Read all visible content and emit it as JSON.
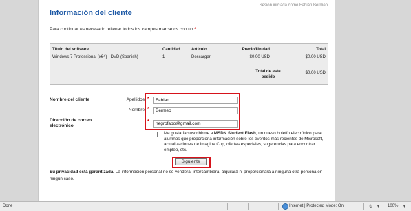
{
  "session": {
    "text": "Sesión iniciada como Fabián Bermeo"
  },
  "page": {
    "title": "Información del cliente",
    "intro": "Para continuar es necesario rellenar todos los campos marcados con un",
    "required_marker": "*.",
    "asterisk": "*"
  },
  "order": {
    "headers": {
      "title": "Título del software",
      "quantity": "Cantidad",
      "article": "Artículo",
      "price": "Precio/Unidad",
      "total": "Total"
    },
    "row": {
      "title": "Windows 7 Professional (x64) - DVD (Spanish)",
      "quantity": "1",
      "article": "Descargar",
      "price": "$0.00 USD",
      "total": "$0.00 USD"
    },
    "total_label": "Total de este pedido",
    "total_value": "$0.00 USD"
  },
  "form": {
    "client_name_label": "Nombre del cliente",
    "surname_label": "Apellidos",
    "surname_value": "Fabian",
    "name_label": "Nombre",
    "name_value": "Bermeo",
    "email_label": "Dirección de correo electrónico",
    "email_value": "negrofabo@gmail.com",
    "newsletter_text_pre": "Me gustaría suscribirme a",
    "newsletter_brand": "MSDN Student Flash",
    "newsletter_text_post": ", un nuevo boletín electrónico para alumnos que proporciona información sobre los eventos más recientes de Microsoft, actualizaciones de Imagine Cup, ofertas especiales, sugerencias para encontrar empleo, etc.",
    "newsletter_checked": false,
    "next_button": "Siguiente"
  },
  "privacy": {
    "bold": "Su privacidad está garantizada.",
    "text": " La información personal no se venderá, intercambiará, alquilará ni proporcionará a ninguna otra persona en ningún caso."
  },
  "statusbar": {
    "done": "Done",
    "zone": "Internet | Protected Mode: On",
    "zoom": "100%"
  }
}
